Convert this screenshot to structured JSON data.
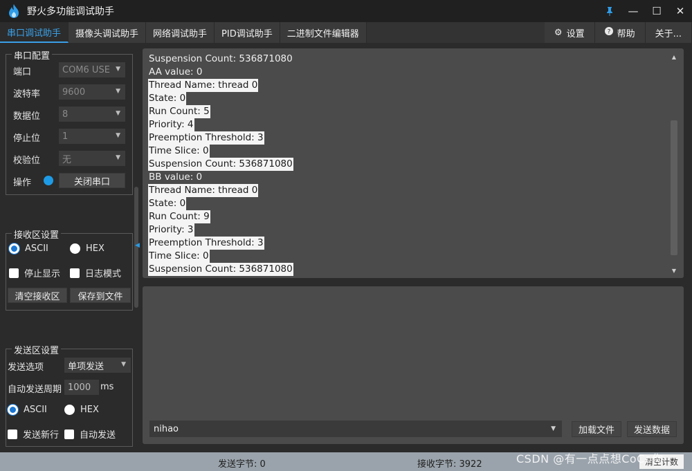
{
  "window": {
    "title": "野火多功能调试助手",
    "controls": {
      "pin": "pin-icon",
      "minimize": "—",
      "maximize": "☐",
      "close": "✕"
    }
  },
  "tabs": [
    {
      "label": "串口调试助手",
      "active": true
    },
    {
      "label": "摄像头调试助手"
    },
    {
      "label": "网络调试助手"
    },
    {
      "label": "PID调试助手"
    },
    {
      "label": "二进制文件编辑器"
    }
  ],
  "tabs_right": [
    {
      "label": "设置",
      "icon": "gear-icon"
    },
    {
      "label": "帮助",
      "icon": "help-icon"
    },
    {
      "label": "关于..."
    }
  ],
  "serial_config": {
    "title": "串口配置",
    "port": {
      "label": "端口",
      "value": "COM6 USE"
    },
    "baud": {
      "label": "波特率",
      "value": "9600"
    },
    "data_bits": {
      "label": "数据位",
      "value": "8"
    },
    "stop_bits": {
      "label": "停止位",
      "value": "1"
    },
    "parity": {
      "label": "校验位",
      "value": "无"
    },
    "operation": {
      "label": "操作",
      "button": "关闭串口"
    }
  },
  "recv_settings": {
    "title": "接收区设置",
    "ascii": "ASCII",
    "hex": "HEX",
    "stop_display": "停止显示",
    "log_mode": "日志模式",
    "clear_btn": "清空接收区",
    "save_btn": "保存到文件"
  },
  "send_settings": {
    "title": "发送区设置",
    "option_label": "发送选项",
    "option_value": "单项发送",
    "period_label": "自动发送周期",
    "period_value": "1000",
    "period_unit": "ms",
    "ascii": "ASCII",
    "hex": "HEX",
    "newline": "发送新行",
    "auto_send": "自动发送"
  },
  "receive_lines": [
    {
      "text": "Suspension Count: 536871080",
      "hl": false
    },
    {
      "text": "AA value: 0",
      "hl": false
    },
    {
      "text": "Thread Name: thread 0",
      "hl": true
    },
    {
      "text": "State: 0",
      "hl": true
    },
    {
      "text": "Run Count: 5",
      "hl": true
    },
    {
      "text": "Priority: 4",
      "hl": true
    },
    {
      "text": "Preemption Threshold: 3",
      "hl": true
    },
    {
      "text": "Time Slice: 0",
      "hl": true
    },
    {
      "text": "Suspension Count: 536871080",
      "hl": true
    },
    {
      "text": "BB value: 0",
      "hl": false
    },
    {
      "text": "Thread Name: thread 0",
      "hl": true
    },
    {
      "text": "State: 0",
      "hl": true
    },
    {
      "text": "Run Count: 9",
      "hl": true
    },
    {
      "text": "Priority: 3",
      "hl": true
    },
    {
      "text": "Preemption Threshold: 3",
      "hl": true
    },
    {
      "text": "Time Slice: 0",
      "hl": true
    },
    {
      "text": "Suspension Count: 536871080",
      "hl": true
    }
  ],
  "send_area": {
    "input_value": "nihao",
    "load_file": "加载文件",
    "send_data": "发送数据"
  },
  "status": {
    "sent": "发送字节: 0",
    "received": "接收字节: 3922",
    "reset_btn": "清空计数"
  },
  "watermark": "CSDN @有一点点想CoCo你",
  "colors": {
    "accent": "#3aa0e8",
    "panel": "#4b4b4b",
    "status_bar": "#9aa3ab"
  }
}
